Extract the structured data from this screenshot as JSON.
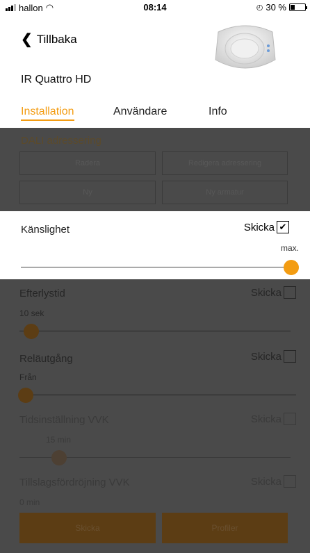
{
  "status": {
    "carrier": "hallon",
    "time": "08:14",
    "battery": "30 %",
    "battery_level": 0.3
  },
  "header": {
    "back": "Tillbaka",
    "device_name": "IR Quattro HD"
  },
  "tabs": [
    {
      "label": "Installation",
      "active": true
    },
    {
      "label": "Användare",
      "active": false
    },
    {
      "label": "Info",
      "active": false
    }
  ],
  "dali": {
    "title": "DALI adressering",
    "buttons": [
      "Radera",
      "Redigera adressering",
      "Ny",
      "Ny armatur"
    ]
  },
  "sensitivity": {
    "label": "Känslighet",
    "send": "Skicka",
    "checked": true,
    "hint": "max.",
    "value": 1.0
  },
  "afterglow": {
    "label": "Efterlystid",
    "send": "Skicka",
    "value_text": "10 sek",
    "value": 0.0
  },
  "relay": {
    "label": "Reläutgång",
    "send": "Skicka",
    "value_text": "Från",
    "value": 0.0
  },
  "time_vvk": {
    "label": "Tidsinställning VVK",
    "send": "Skicka",
    "value_text": "15 min",
    "value": 0.15
  },
  "delay_vvk": {
    "label": "Tillslagsfördröjning VVK",
    "send": "Skicka",
    "value_text": "0 min"
  },
  "footer": {
    "send": "Skicka",
    "profiles": "Profiler"
  },
  "colors": {
    "accent": "#f39c12",
    "dim_bg": "#4a4a4a"
  }
}
